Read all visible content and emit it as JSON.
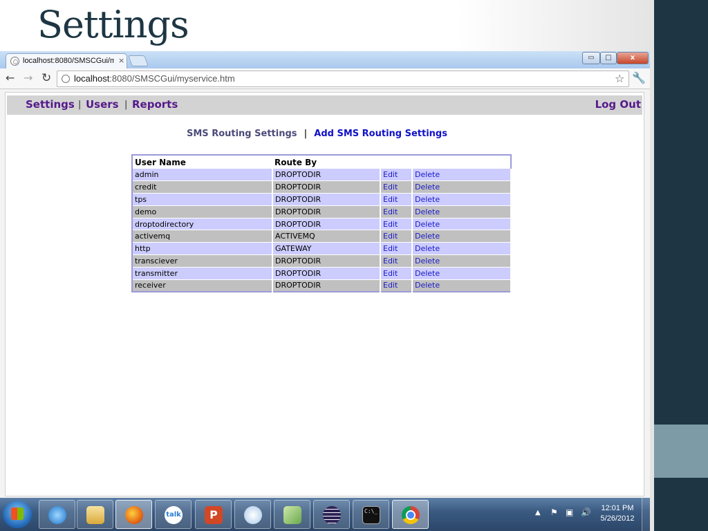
{
  "slide": {
    "title": "Settings"
  },
  "browser": {
    "tab_title": "localhost:8080/SMSCGui/m",
    "tab_close": "×",
    "url_host": "localhost",
    "url_rest": ":8080/SMSCGui/myservice.htm",
    "window_controls": {
      "minimize": "▭",
      "maximize": "□",
      "close": "x"
    }
  },
  "app": {
    "nav": {
      "settings": "Settings",
      "users": "Users",
      "reports": "Reports",
      "separator": "|",
      "logout": "Log Out"
    },
    "subnav": {
      "current": "SMS Routing Settings",
      "separator": "|",
      "add": "Add SMS Routing Settings"
    },
    "table": {
      "headers": [
        "User Name",
        "Route By",
        "",
        ""
      ],
      "rows": [
        {
          "user": "admin",
          "route": "DROPTODIR",
          "edit": "Edit",
          "delete": "Delete"
        },
        {
          "user": "credit",
          "route": "DROPTODIR",
          "edit": "Edit",
          "delete": "Delete"
        },
        {
          "user": "tps",
          "route": "DROPTODIR",
          "edit": "Edit",
          "delete": "Delete"
        },
        {
          "user": "demo",
          "route": "DROPTODIR",
          "edit": "Edit",
          "delete": "Delete"
        },
        {
          "user": "droptodirectory",
          "route": "DROPTODIR",
          "edit": "Edit",
          "delete": "Delete"
        },
        {
          "user": "activemq",
          "route": "ACTIVEMQ",
          "edit": "Edit",
          "delete": "Delete"
        },
        {
          "user": "http",
          "route": "GATEWAY",
          "edit": "Edit",
          "delete": "Delete"
        },
        {
          "user": "transciever",
          "route": "DROPTODIR",
          "edit": "Edit",
          "delete": "Delete"
        },
        {
          "user": "transmitter",
          "route": "DROPTODIR",
          "edit": "Edit",
          "delete": "Delete"
        },
        {
          "user": "receiver",
          "route": "DROPTODIR",
          "edit": "Edit",
          "delete": "Delete"
        }
      ]
    }
  },
  "taskbar": {
    "apps": [
      "internet-explorer-icon",
      "file-explorer-icon",
      "firefox-icon",
      "google-talk-icon",
      "powerpoint-icon",
      "paint-icon",
      "notepad-icon",
      "eclipse-icon",
      "command-prompt-icon",
      "chrome-icon"
    ],
    "talk_label": "talk",
    "ppt_label": "P",
    "cmd_label": "C:\\_",
    "clock_time": "12:01 PM",
    "clock_date": "5/26/2012"
  },
  "colors": {
    "slide_accent": "#1e3644",
    "nav_link": "#551a8b",
    "row_odd": "#ccccff",
    "row_even": "#c0c0c0",
    "action_link": "#1a1ac8"
  }
}
